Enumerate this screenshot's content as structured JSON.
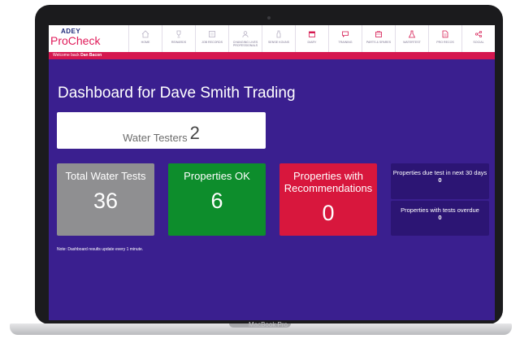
{
  "app": {
    "brand_top": "ADEY",
    "brand_name": "ProCheck"
  },
  "nav": [
    {
      "label": "HOME",
      "icon": "home-icon"
    },
    {
      "label": "REWARDS",
      "icon": "trophy-icon"
    },
    {
      "label": "JOB RECORDS",
      "icon": "records-icon"
    },
    {
      "label": "CHANGING LIVES PROFESSIONALS",
      "icon": "users-icon"
    },
    {
      "label": "SENSE KOUNS",
      "icon": "bottle-icon"
    },
    {
      "label": "DIARY",
      "icon": "calendar-icon"
    },
    {
      "label": "TRAINING",
      "icon": "chat-icon"
    },
    {
      "label": "PARTS & SPARES",
      "icon": "parts-icon"
    },
    {
      "label": "WATERTEST",
      "icon": "flask-icon"
    },
    {
      "label": "PRO RECOS",
      "icon": "document-icon"
    },
    {
      "label": "SOCIAL",
      "icon": "share-icon"
    }
  ],
  "welcome": {
    "prefix": "Welcome back",
    "user": "Dan Bacon"
  },
  "dashboard": {
    "title": "Dashboard for Dave Smith Trading",
    "water_testers": {
      "label": "Water Testers",
      "value": "2"
    },
    "tiles": [
      {
        "label": "Total Water Tests",
        "value": "36",
        "color": "#8f8f91"
      },
      {
        "label": "Properties OK",
        "value": "6",
        "color": "#0d8d2c"
      },
      {
        "label": "Properties with Recommendations",
        "value": "0",
        "color": "#d8173d"
      }
    ],
    "side": [
      {
        "label": "Properties due test in next 30 days",
        "value": "0"
      },
      {
        "label": "Properties with tests overdue",
        "value": "0"
      }
    ],
    "note": "Note: Dashboard results update every 1 minute."
  },
  "device": {
    "model": "MacBook Pro"
  },
  "colors": {
    "background": "#3a1f8f",
    "accent_pink": "#d5174f",
    "brand_navy": "#1f2a7a"
  }
}
